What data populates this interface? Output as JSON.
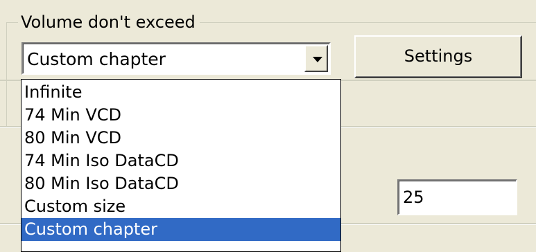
{
  "group": {
    "title": "Volume don't exceed"
  },
  "combo": {
    "value": "Custom chapter"
  },
  "settings_button": {
    "label": "Settings"
  },
  "number_field": {
    "value": "25"
  },
  "dropdown": {
    "items": [
      "Infinite",
      "74 Min VCD",
      "80 Min VCD",
      "74 Min Iso DataCD",
      "80 Min Iso DataCD",
      "Custom size",
      "Custom chapter"
    ],
    "selected_index": 6
  },
  "colors": {
    "highlight": "#316ac5",
    "face": "#ece9d8"
  }
}
